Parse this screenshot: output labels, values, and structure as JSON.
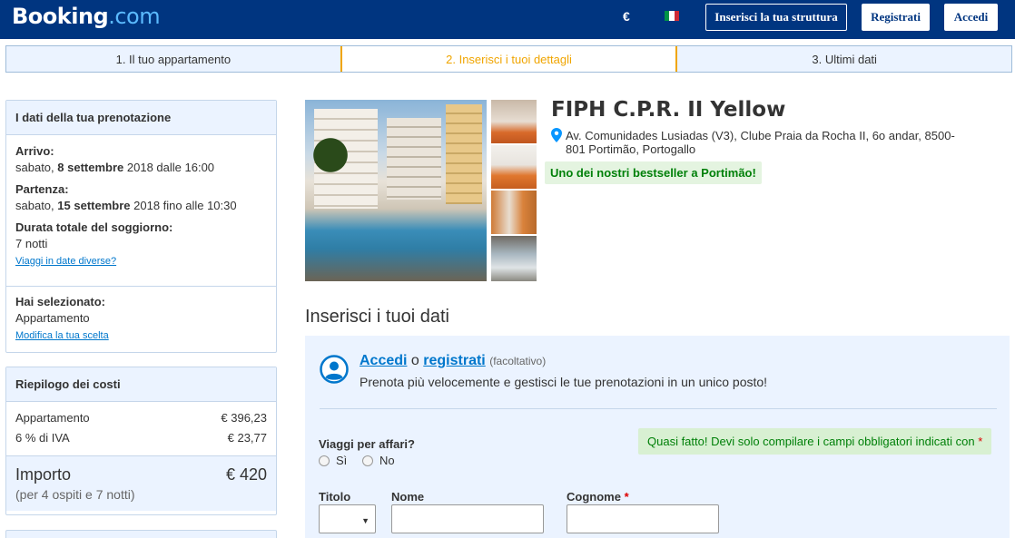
{
  "header": {
    "logo_main": "Booking",
    "logo_suffix": ".com",
    "currency": "€",
    "flag_colors": [
      "#009246",
      "#ffffff",
      "#ce2b37"
    ],
    "list_property": "Inserisci la tua struttura",
    "register": "Registrati",
    "login": "Accedi"
  },
  "steps": [
    {
      "label": "1. Il tuo appartamento"
    },
    {
      "label": "2. Inserisci i tuoi dettagli"
    },
    {
      "label": "3. Ultimi dati"
    }
  ],
  "booking_details": {
    "title": "I dati della tua prenotazione",
    "arrival_label": "Arrivo:",
    "arrival_day": "sabato,",
    "arrival_date": "8 settembre",
    "arrival_rest": "2018 dalle 16:00",
    "departure_label": "Partenza:",
    "departure_day": "sabato,",
    "departure_date": "15 settembre",
    "departure_rest": "2018 fino alle 10:30",
    "duration_label": "Durata totale del soggiorno:",
    "duration_value": "7 notti",
    "change_dates": "Viaggi in date diverse?",
    "selected_label": "Hai selezionato:",
    "selected_value": "Appartamento",
    "change_choice": "Modifica la tua scelta"
  },
  "cost_summary": {
    "title": "Riepilogo dei costi",
    "rows": [
      {
        "label": "Appartamento",
        "value": "€ 396,23"
      },
      {
        "label": "6 % di IVA",
        "value": "€ 23,77"
      }
    ],
    "total_label": "Importo",
    "total_value": "€ 420",
    "total_note": "(per 4 ospiti e 7 notti)"
  },
  "hotel": {
    "name": "FIPH C.P.R. II Yellow",
    "address": "Av. Comunidades Lusiadas (V3), Clube Praia da Rocha II, 6o andar, 8500-801 Portimão, Portogallo",
    "badge": "Uno dei nostri bestseller a Portimão!"
  },
  "form": {
    "section_title": "Inserisci i tuoi dati",
    "login_link": "Accedi",
    "or": "o",
    "register_link": "registrati",
    "optional": "(facoltativo)",
    "login_sub": "Prenota più velocemente e gestisci le tue prenotazioni in un unico posto!",
    "almost_done": "Quasi fatto! Devi solo compilare i campi obbligatori indicati con",
    "required_mark": "*",
    "business_label": "Viaggi per affari?",
    "yes": "Sì",
    "no": "No",
    "title_label": "Titolo",
    "first_name_label": "Nome",
    "last_name_label": "Cognome"
  }
}
